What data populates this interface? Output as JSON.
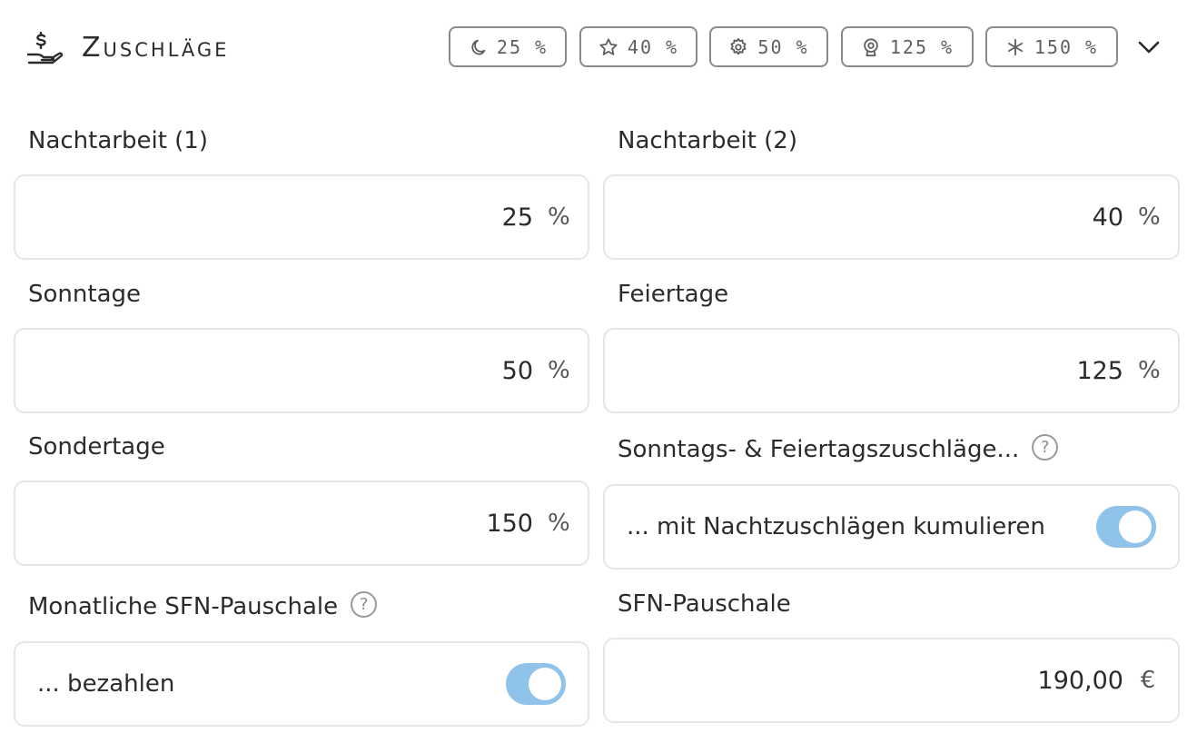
{
  "header": {
    "title": "Zuschläge",
    "icon": "hand-money-icon",
    "chips": [
      {
        "icon": "moon-icon",
        "label": "25 %"
      },
      {
        "icon": "star-icon",
        "label": "40 %"
      },
      {
        "icon": "gear-icon",
        "label": "50 %"
      },
      {
        "icon": "award-icon",
        "label": "125 %"
      },
      {
        "icon": "asterisk-icon",
        "label": "150 %"
      }
    ],
    "collapse_icon": "chevron-down-icon"
  },
  "fields": {
    "nachtarbeit1": {
      "label": "Nachtarbeit (1)",
      "value": "25",
      "unit": "%"
    },
    "nachtarbeit2": {
      "label": "Nachtarbeit (2)",
      "value": "40",
      "unit": "%"
    },
    "sonntage": {
      "label": "Sonntage",
      "value": "50",
      "unit": "%"
    },
    "feiertage": {
      "label": "Feiertage",
      "value": "125",
      "unit": "%"
    },
    "sondertage": {
      "label": "Sondertage",
      "value": "150",
      "unit": "%"
    },
    "sfn_pauschale": {
      "label": "SFN-Pauschale",
      "value": "190,00",
      "unit": "€"
    }
  },
  "toggles": {
    "kumulieren": {
      "label": "Sonntags- & Feiertagszuschläge...",
      "text": "... mit Nachtzuschlägen kumulieren",
      "help": "?",
      "on": true
    },
    "monatlich": {
      "label": "Monatliche SFN-Pauschale",
      "text": "... bezahlen",
      "help": "?",
      "on": true
    }
  },
  "colors": {
    "toggle_on": "#8fc3ea",
    "chip_border": "#8a8a8a",
    "field_border": "#e6e6e6"
  }
}
